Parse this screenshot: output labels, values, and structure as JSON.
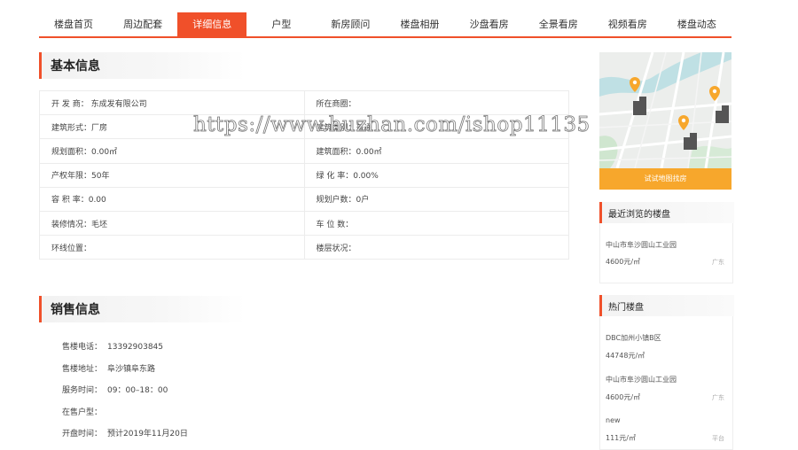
{
  "nav": {
    "tabs": [
      {
        "label": "楼盘首页",
        "active": false
      },
      {
        "label": "周边配套",
        "active": false
      },
      {
        "label": "详细信息",
        "active": true
      },
      {
        "label": "户型",
        "active": false
      },
      {
        "label": "新房顾问",
        "active": false
      },
      {
        "label": "楼盘相册",
        "active": false
      },
      {
        "label": "沙盘看房",
        "active": false
      },
      {
        "label": "全景看房",
        "active": false
      },
      {
        "label": "视频看房",
        "active": false
      },
      {
        "label": "楼盘动态",
        "active": false
      }
    ]
  },
  "basic": {
    "title": "基本信息",
    "rows": [
      [
        "开 发 商：  东成发有限公司",
        "所在商圈："
      ],
      [
        "建筑形式：厂房",
        "建筑类别：普通"
      ],
      [
        "规划面积：0.00㎡",
        "建筑面积：0.00㎡"
      ],
      [
        "产权年限：50年",
        "绿 化 率：0.00%"
      ],
      [
        "容 积 率：0.00",
        "规划户数：0户"
      ],
      [
        "装修情况：毛坯",
        "车 位 数："
      ],
      [
        "环线位置：",
        "楼层状况："
      ]
    ]
  },
  "sales": {
    "title": "销售信息",
    "rows": [
      {
        "label": "售楼电话：",
        "value": "13392903845"
      },
      {
        "label": "售楼地址：",
        "value": "阜沙镇阜东路"
      },
      {
        "label": "服务时间：",
        "value": "09：00–18：00"
      },
      {
        "label": "在售户型：",
        "value": ""
      },
      {
        "label": "开盘时间：",
        "value": "预计2019年11月20日"
      }
    ]
  },
  "watermark": "https://www.huzhan.com/ishop11135",
  "map": {
    "button": "试试地图找房"
  },
  "recent": {
    "title": "最近浏览的楼盘",
    "items": [
      {
        "name": "中山市阜沙圆山工业园",
        "price": "4600元/㎡",
        "region": "广东"
      }
    ]
  },
  "hot": {
    "title": "热门楼盘",
    "items": [
      {
        "name": "DBC加州小镇B区",
        "price": "44748元/㎡",
        "region": ""
      },
      {
        "name": "中山市阜沙圆山工业园",
        "price": "4600元/㎡",
        "region": "广东"
      },
      {
        "name": "new",
        "price": "111元/㎡",
        "region": "平台"
      }
    ]
  },
  "colors": {
    "accent": "#f0502a",
    "map_button": "#f7a72c",
    "pin": "#f7a72c"
  }
}
